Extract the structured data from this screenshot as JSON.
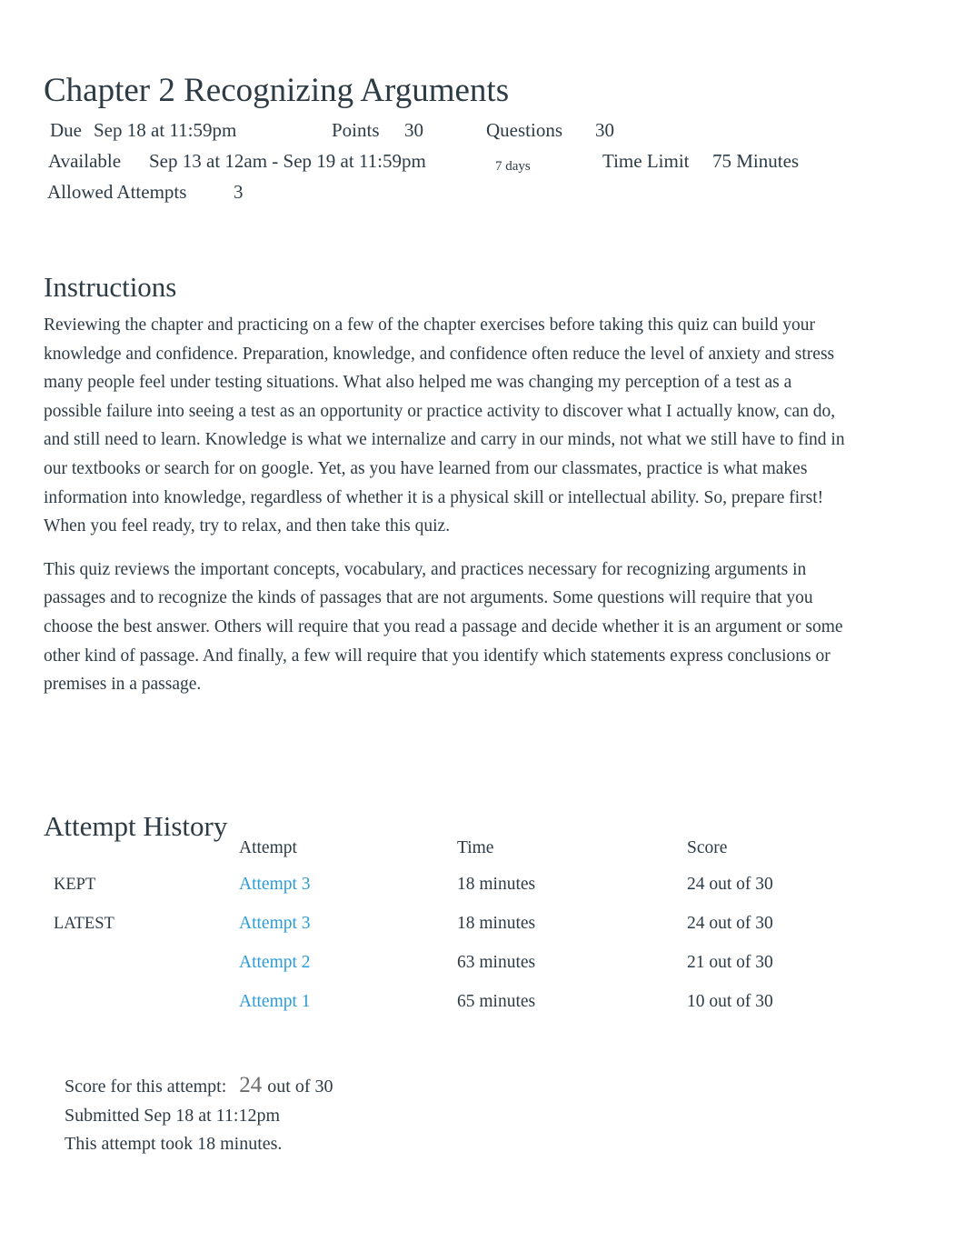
{
  "quiz": {
    "title": "Chapter 2 Recognizing Arguments",
    "meta": {
      "due_label": "Due",
      "due_value": "Sep 18 at 11:59pm",
      "points_label": "Points",
      "points_value": "30",
      "questions_label": "Questions",
      "questions_value": "30",
      "available_label": "Available",
      "available_value": "Sep 13 at 12am - Sep 19 at 11:59pm",
      "available_duration": "7 days",
      "time_limit_label": "Time Limit",
      "time_limit_value": "75 Minutes",
      "allowed_attempts_label": "Allowed Attempts",
      "allowed_attempts_value": "3"
    }
  },
  "instructions": {
    "heading": "Instructions",
    "paragraphs": [
      "Reviewing the chapter and practicing on a few of the chapter exercises before taking this quiz can build your knowledge and confidence. Preparation, knowledge, and confidence often reduce the level of anxiety and stress many people feel under testing situations. What also helped me was changing my perception of a test as a possible failure into seeing a test as an opportunity or practice activity to discover what I actually know, can do, and still need to learn. Knowledge is what we internalize and carry in our minds, not what we still have to find in our textbooks or search for on google. Yet, as you have learned from our classmates, practice is what makes information into knowledge, regardless of whether it is a physical skill or intellectual ability. So, prepare first! When you feel ready, try to relax, and then take this quiz.",
      "This quiz reviews the important concepts, vocabulary, and practices necessary for recognizing arguments in passages and to recognize the kinds of passages that are not arguments. Some questions will require that you choose the best answer. Others will require that you read a passage and decide whether it is an argument or some other kind of passage. And finally, a few will require that you identify which statements express conclusions or premises in a passage."
    ]
  },
  "attempt_history": {
    "heading": "Attempt History",
    "columns": [
      "",
      "Attempt",
      "Time",
      "Score"
    ],
    "rows": [
      {
        "tag": "KEPT",
        "attempt": "Attempt 3",
        "time": "18 minutes",
        "score": "24 out of 30"
      },
      {
        "tag": "LATEST",
        "attempt": "Attempt 3",
        "time": "18 minutes",
        "score": "24 out of 30"
      },
      {
        "tag": "",
        "attempt": "Attempt 2",
        "time": "63 minutes",
        "score": "21 out of 30"
      },
      {
        "tag": "",
        "attempt": "Attempt 1",
        "time": "65 minutes",
        "score": "10 out of 30"
      }
    ]
  },
  "score_summary": {
    "score_label": "Score for this attempt:",
    "score_number": "24",
    "score_outof": "out of 30",
    "submitted": "Submitted Sep 18 at 11:12pm",
    "duration": "This attempt took 18 minutes."
  },
  "colors": {
    "link": "#2b9cd8",
    "text": "#2d3b45",
    "score_number": "#6b6b6b"
  }
}
